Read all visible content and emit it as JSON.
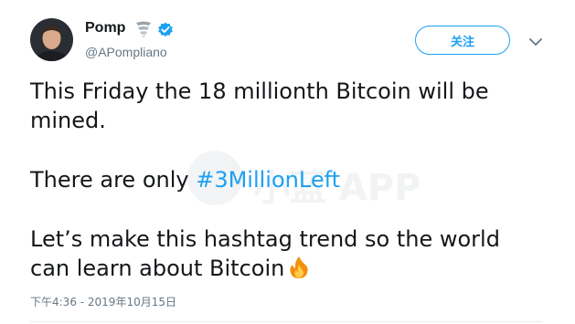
{
  "user": {
    "display_name": "Pomp",
    "name_emoji": "tornado-emoji",
    "handle": "@APompliano",
    "verified": true
  },
  "follow_button": {
    "label": "关注"
  },
  "tweet": {
    "line1": "This Friday the 18 millionth Bitcoin will be mined.",
    "line2_prefix": "There are only ",
    "hashtag": "#3MillionLeft",
    "line3": "Let’s make this hashtag trend so the world can learn about Bitcoin",
    "trailing_emoji": "fire-emoji",
    "timestamp": "下午4:36 - 2019年10月15日"
  },
  "watermark": {
    "text": "小蓝 APP"
  },
  "colors": {
    "accent": "#1da1f2",
    "text": "#14171a",
    "muted": "#657786",
    "divider": "#e6ecf0"
  }
}
